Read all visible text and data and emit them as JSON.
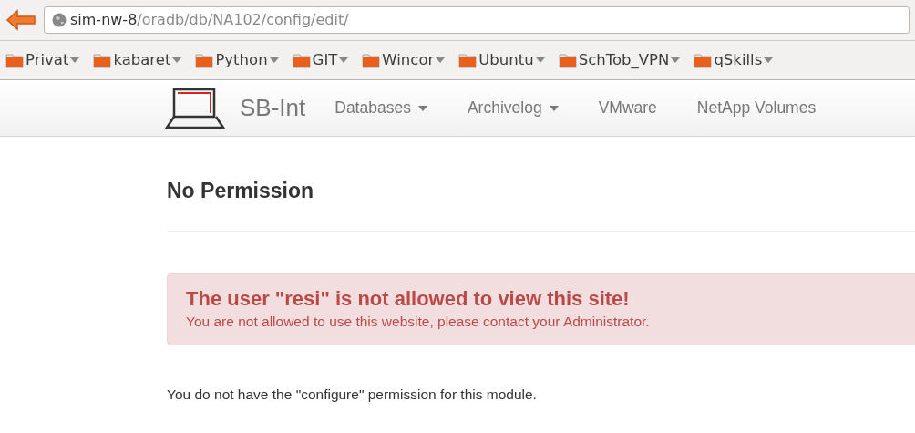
{
  "browser": {
    "url_host": "sim-nw-8",
    "url_path": "/oradb/db/NA102/config/edit/",
    "bookmarks": [
      {
        "label": "Privat"
      },
      {
        "label": "kabaret"
      },
      {
        "label": "Python"
      },
      {
        "label": "GIT"
      },
      {
        "label": "Wincor"
      },
      {
        "label": "Ubuntu"
      },
      {
        "label": "SchTob_VPN"
      },
      {
        "label": "qSkills"
      }
    ]
  },
  "navbar": {
    "brand": "SB-Int",
    "items": [
      {
        "label": "Databases",
        "dropdown": true
      },
      {
        "label": "Archivelog",
        "dropdown": true
      },
      {
        "label": "VMware",
        "dropdown": false
      },
      {
        "label": "NetApp Volumes",
        "dropdown": false
      }
    ]
  },
  "page": {
    "heading": "No Permission",
    "alert": {
      "title": "The user \"resi\" is not allowed to view this site!",
      "message": "You are not allowed to use this website, please contact your Administrator."
    },
    "note": "You do not have the \"configure\" permission for this module."
  }
}
